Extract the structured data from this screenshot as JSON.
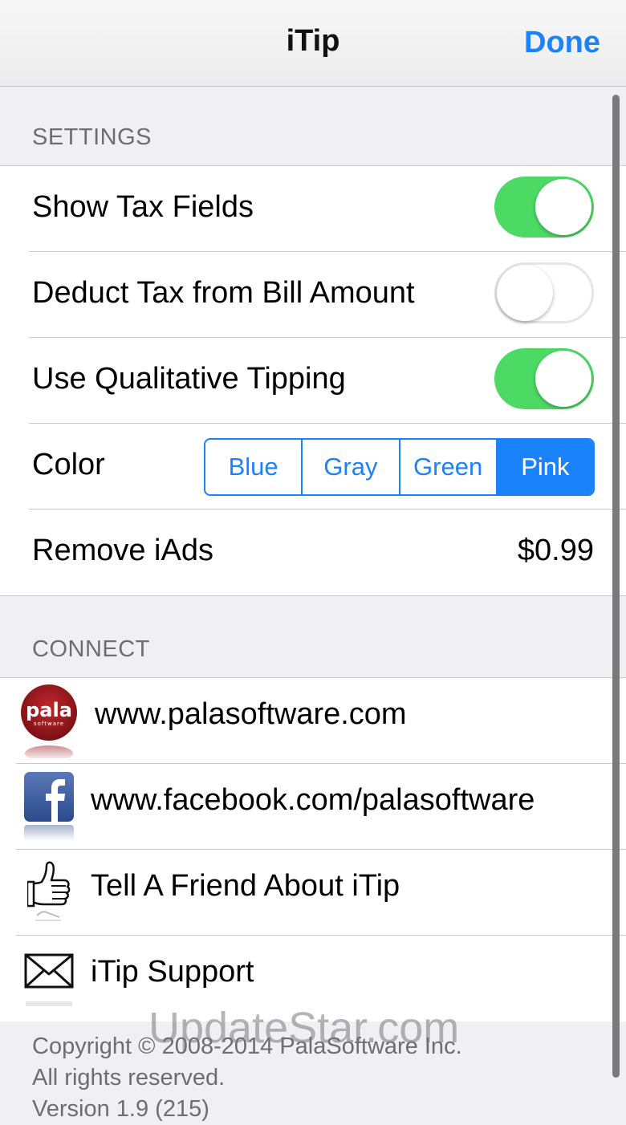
{
  "navbar": {
    "title": "iTip",
    "done_label": "Done"
  },
  "settings": {
    "header": "SETTINGS",
    "rows": [
      {
        "label": "Show Tax Fields",
        "toggle": "on"
      },
      {
        "label": "Deduct Tax from Bill Amount",
        "toggle": "off"
      },
      {
        "label": "Use Qualitative Tipping",
        "toggle": "on"
      }
    ],
    "color": {
      "label": "Color",
      "options": [
        "Blue",
        "Gray",
        "Green",
        "Pink"
      ],
      "selected": "Pink"
    },
    "remove_ads": {
      "label": "Remove iAds",
      "price": "$0.99"
    }
  },
  "connect": {
    "header": "CONNECT",
    "items": [
      {
        "label": "www.palasoftware.com",
        "icon": "pala-logo-icon",
        "logo_text": "pala",
        "logo_subtext": "software"
      },
      {
        "label": "www.facebook.com/palasoftware",
        "icon": "facebook-icon"
      },
      {
        "label": "Tell A Friend About iTip",
        "icon": "thumbs-up-icon"
      },
      {
        "label": "iTip Support",
        "icon": "envelope-icon"
      }
    ]
  },
  "footer": {
    "line1": "Copyright © 2008-2014 PalaSoftware Inc.",
    "line2": "All rights reserved.",
    "line3": "Version 1.9 (215)"
  },
  "watermark": "UpdateStar.com",
  "colors": {
    "accent": "#1a82fb",
    "toggle_on": "#4cd964",
    "group_bg": "#efeff4"
  }
}
